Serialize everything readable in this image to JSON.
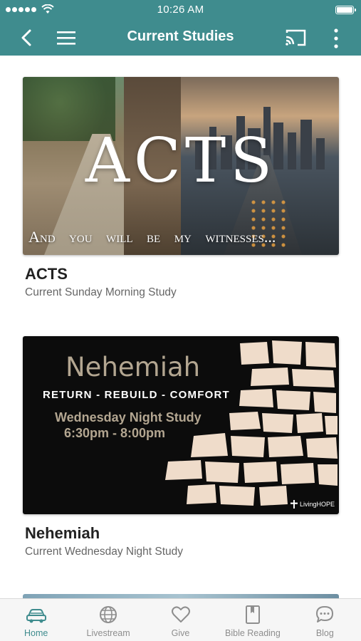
{
  "status_bar": {
    "time": "10:26 AM"
  },
  "nav": {
    "title": "Current Studies"
  },
  "studies": [
    {
      "title": "ACTS",
      "subtitle": "Current Sunday Morning Study",
      "art": {
        "word": "ACTS",
        "tagline": "And you will be my witnesses..."
      }
    },
    {
      "title": "Nehemiah",
      "subtitle": "Current Wednesday Night Study",
      "art": {
        "heading": "Nehemiah",
        "line": "RETURN - REBUILD - COMFORT",
        "night": "Wednesday Night Study",
        "time": "6:30pm - 8:00pm",
        "logo": "LivingHOPE"
      }
    }
  ],
  "tabs": [
    {
      "label": "Home",
      "icon": "car-icon",
      "active": true
    },
    {
      "label": "Livestream",
      "icon": "globe-icon",
      "active": false
    },
    {
      "label": "Give",
      "icon": "heart-icon",
      "active": false
    },
    {
      "label": "Bible Reading",
      "icon": "book-icon",
      "active": false
    },
    {
      "label": "Blog",
      "icon": "chat-bubble-icon",
      "active": false
    }
  ],
  "colors": {
    "primary": "#3f8c8e",
    "tab_inactive": "#8e8e8e",
    "art_beige": "#efdcca",
    "art_tan": "#b3a691"
  }
}
